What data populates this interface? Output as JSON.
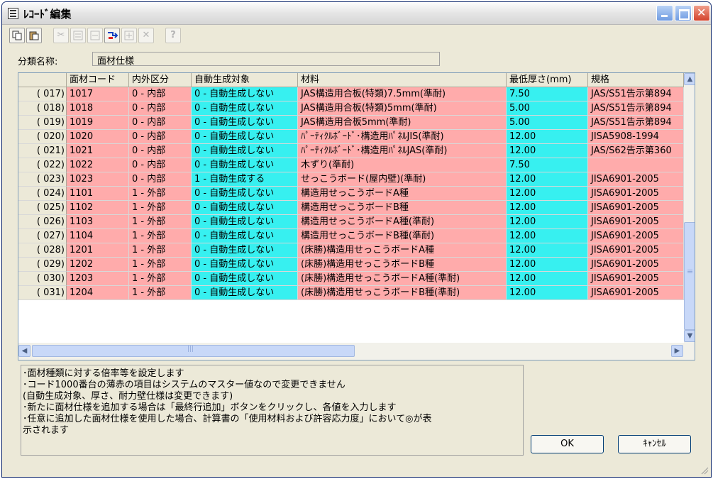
{
  "window": {
    "title": "ﾚｺｰﾄﾞ編集"
  },
  "toolbar": {
    "tools": [
      {
        "name": "copy-icon",
        "glyph": "⎘"
      },
      {
        "name": "paste-icon",
        "glyph": "📋"
      },
      {
        "name": "cut-icon",
        "glyph": "✂"
      },
      {
        "name": "paste-rows-icon",
        "glyph": "▤"
      },
      {
        "name": "insert-row-icon",
        "glyph": "▤"
      },
      {
        "name": "append-row-icon",
        "glyph": "→"
      },
      {
        "name": "add-row-icon",
        "glyph": "▤"
      },
      {
        "name": "delete-icon",
        "glyph": "✕"
      },
      {
        "name": "help-icon",
        "glyph": "?"
      }
    ]
  },
  "category": {
    "label": "分類名称:",
    "value": "面材仕様"
  },
  "grid": {
    "headers": [
      "",
      "面材コード",
      "内外区分",
      "自動生成対象",
      "材料",
      "最低厚さ(mm)",
      "規格"
    ],
    "rows": [
      {
        "idx": "( 017)",
        "code": "1017",
        "kubun": "0 - 内部",
        "auto": "0 - 自動生成しない",
        "material": "JAS構造用合板(特類)7.5mm(準耐)",
        "thick": "7.50",
        "spec": "JAS/S51告示第894"
      },
      {
        "idx": "( 018)",
        "code": "1018",
        "kubun": "0 - 内部",
        "auto": "0 - 自動生成しない",
        "material": "JAS構造用合板(特類)5mm(準耐)",
        "thick": "5.00",
        "spec": "JAS/S51告示第894"
      },
      {
        "idx": "( 019)",
        "code": "1019",
        "kubun": "0 - 内部",
        "auto": "0 - 自動生成しない",
        "material": "JAS構造用合板5mm(準耐)",
        "thick": "5.00",
        "spec": "JAS/S51告示第894"
      },
      {
        "idx": "( 020)",
        "code": "1020",
        "kubun": "0 - 内部",
        "auto": "0 - 自動生成しない",
        "material": "ﾊﾟｰﾃｨｸﾙﾎﾞｰﾄﾞ･構造用ﾊﾟﾈﾙJIS(準耐)",
        "thick": "12.00",
        "spec": "JISA5908-1994"
      },
      {
        "idx": "( 021)",
        "code": "1021",
        "kubun": "0 - 内部",
        "auto": "0 - 自動生成しない",
        "material": "ﾊﾟｰﾃｨｸﾙﾎﾞｰﾄﾞ･構造用ﾊﾟﾈﾙJAS(準耐)",
        "thick": "12.00",
        "spec": "JAS/S62告示第360"
      },
      {
        "idx": "( 022)",
        "code": "1022",
        "kubun": "0 - 内部",
        "auto": "0 - 自動生成しない",
        "material": "木ずり(準耐)",
        "thick": "7.50",
        "spec": ""
      },
      {
        "idx": "( 023)",
        "code": "1023",
        "kubun": "0 - 内部",
        "auto": "1 - 自動生成する",
        "material": "せっこうボード(屋内壁)(準耐)",
        "thick": "12.00",
        "spec": "JISA6901-2005"
      },
      {
        "idx": "( 024)",
        "code": "1101",
        "kubun": "1 - 外部",
        "auto": "0 - 自動生成しない",
        "material": "構造用せっこうボードA種",
        "thick": "12.00",
        "spec": "JISA6901-2005"
      },
      {
        "idx": "( 025)",
        "code": "1102",
        "kubun": "1 - 外部",
        "auto": "0 - 自動生成しない",
        "material": "構造用せっこうボードB種",
        "thick": "12.00",
        "spec": "JISA6901-2005"
      },
      {
        "idx": "( 026)",
        "code": "1103",
        "kubun": "1 - 外部",
        "auto": "0 - 自動生成しない",
        "material": "構造用せっこうボードA種(準耐)",
        "thick": "12.00",
        "spec": "JISA6901-2005"
      },
      {
        "idx": "( 027)",
        "code": "1104",
        "kubun": "1 - 外部",
        "auto": "0 - 自動生成しない",
        "material": "構造用せっこうボードB種(準耐)",
        "thick": "12.00",
        "spec": "JISA6901-2005"
      },
      {
        "idx": "( 028)",
        "code": "1201",
        "kubun": "1 - 外部",
        "auto": "0 - 自動生成しない",
        "material": "(床勝)構造用せっこうボードA種",
        "thick": "12.00",
        "spec": "JISA6901-2005"
      },
      {
        "idx": "( 029)",
        "code": "1202",
        "kubun": "1 - 外部",
        "auto": "0 - 自動生成しない",
        "material": "(床勝)構造用せっこうボードB種",
        "thick": "12.00",
        "spec": "JISA6901-2005"
      },
      {
        "idx": "( 030)",
        "code": "1203",
        "kubun": "1 - 外部",
        "auto": "0 - 自動生成しない",
        "material": "(床勝)構造用せっこうボードA種(準耐)",
        "thick": "12.00",
        "spec": "JISA6901-2005"
      },
      {
        "idx": "( 031)",
        "code": "1204",
        "kubun": "1 - 外部",
        "auto": "0 - 自動生成しない",
        "material": "(床勝)構造用せっこうボードB種(準耐)",
        "thick": "12.00",
        "spec": "JISA6901-2005"
      }
    ],
    "colors": {
      "pink": "#ffabab",
      "cyan": "#37f0f0"
    }
  },
  "notes": [
    "･面材種類に対する倍率等を設定します",
    "･コード1000番台の薄赤の項目はシステムのマスター値なので変更できません",
    "(自動生成対象、厚さ、耐力壁仕様は変更できます)",
    "･新たに面材仕様を追加する場合は「最終行追加」ボタンをクリックし、各値を入力します",
    "･任意に追加した面材仕様を使用した場合、計算書の「使用材料および許容応力度」において◎が表",
    "示されます"
  ],
  "buttons": {
    "ok": "OK",
    "cancel": "ｷｬﾝｾﾙ"
  }
}
